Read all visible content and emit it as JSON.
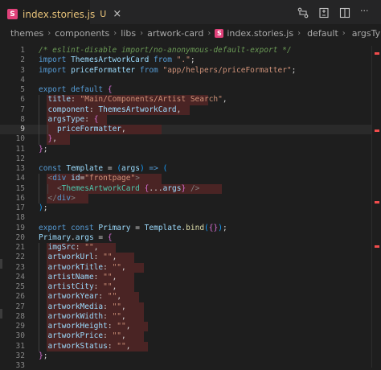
{
  "tab": {
    "icon_letter": "S",
    "title": "index.stories.js",
    "status": "U",
    "close": "×"
  },
  "actions": {
    "icons": [
      "compare-changes-icon",
      "open-changes-icon",
      "split-editor-icon",
      "more-actions-icon"
    ],
    "more": "···"
  },
  "breadcrumbs": {
    "items": [
      "themes",
      "components",
      "libs",
      "artwork-card"
    ],
    "file": "index.stories.js",
    "symbols": [
      "default",
      "argsType"
    ],
    "sep": "›"
  },
  "editor": {
    "current_line": 9,
    "lines": [
      {
        "n": "1",
        "text": "/* eslint-disable import/no-anonymous-default-export */"
      },
      {
        "n": "2",
        "text": "import ThemesArtworkCard from \".\";"
      },
      {
        "n": "3",
        "text": "import priceFormatter from \"app/helpers/priceFormatter\";"
      },
      {
        "n": "4",
        "text": ""
      },
      {
        "n": "5",
        "text": "export default {"
      },
      {
        "n": "6",
        "text": "  title: \"Main/Components/Artist Search\","
      },
      {
        "n": "7",
        "text": "  component: ThemesArtworkCard,"
      },
      {
        "n": "8",
        "text": "  argsType: {"
      },
      {
        "n": "9",
        "text": "    priceFormatter,"
      },
      {
        "n": "10",
        "text": "  },"
      },
      {
        "n": "11",
        "text": "};"
      },
      {
        "n": "12",
        "text": ""
      },
      {
        "n": "13",
        "text": "const Template = (args) => ("
      },
      {
        "n": "14",
        "text": "  <div id=\"frontpage\">"
      },
      {
        "n": "15",
        "text": "    <ThemesArtworkCard {...args} />"
      },
      {
        "n": "16",
        "text": "  </div>"
      },
      {
        "n": "17",
        "text": ");"
      },
      {
        "n": "18",
        "text": ""
      },
      {
        "n": "19",
        "text": "export const Primary = Template.bind({});"
      },
      {
        "n": "20",
        "text": "Primary.args = {"
      },
      {
        "n": "21",
        "text": "  imgSrc: \"\","
      },
      {
        "n": "22",
        "text": "  artworkUrl: \"\","
      },
      {
        "n": "23",
        "text": "  artworkTitle: \"\","
      },
      {
        "n": "24",
        "text": "  artistName: \"\","
      },
      {
        "n": "25",
        "text": "  artistCity: \"\","
      },
      {
        "n": "26",
        "text": "  artworkYear: \"\","
      },
      {
        "n": "27",
        "text": "  artworkMedia: \"\","
      },
      {
        "n": "28",
        "text": "  artworkWidth: \"\","
      },
      {
        "n": "29",
        "text": "  artworkHeight: \"\","
      },
      {
        "n": "30",
        "text": "  artworkPrice: \"\","
      },
      {
        "n": "31",
        "text": "  artworkStatus: \"\","
      },
      {
        "n": "32",
        "text": "};"
      },
      {
        "n": "33",
        "text": ""
      }
    ]
  },
  "colors": {
    "tab_title": "#e8c37a",
    "storybook": "#e0417a",
    "error_bg": "#4a2424"
  }
}
